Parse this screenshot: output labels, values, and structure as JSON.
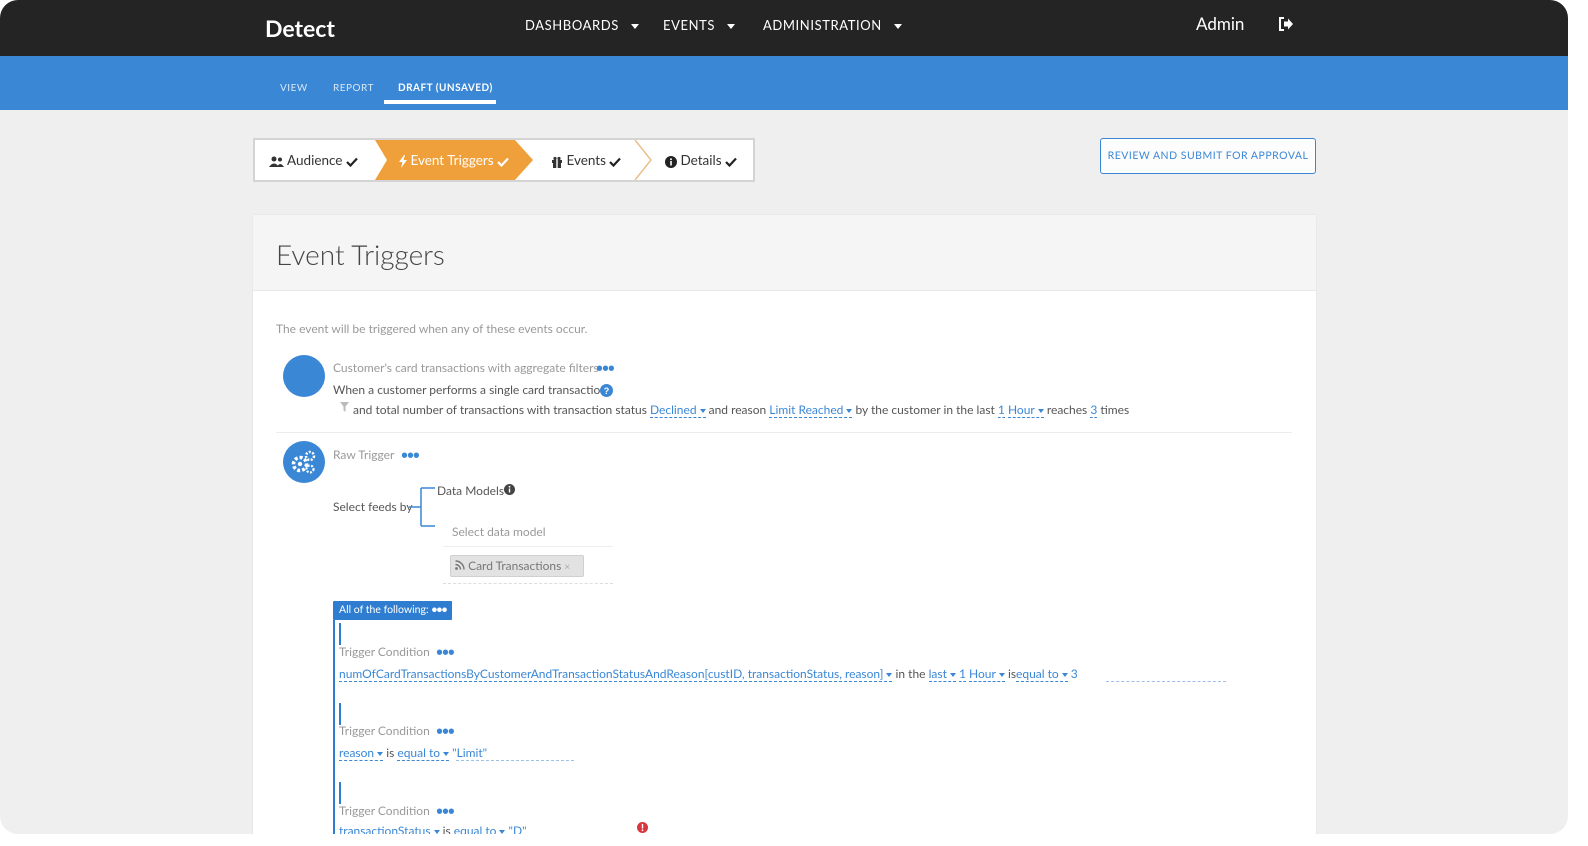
{
  "app": {
    "brand": "Detect"
  },
  "nav": {
    "items": [
      "DASHBOARDS",
      "EVENTS",
      "ADMINISTRATION"
    ],
    "user": "Admin"
  },
  "subnav": {
    "tabs": [
      "VIEW",
      "REPORT",
      "DRAFT (UNSAVED)"
    ],
    "active_tab": "DRAFT (UNSAVED)"
  },
  "wizard": {
    "steps": [
      {
        "label": "Audience",
        "icon": "users-icon",
        "done": true
      },
      {
        "label": "Event Triggers",
        "icon": "bolt-icon",
        "done": true,
        "active": true
      },
      {
        "label": "Events",
        "icon": "gift-icon",
        "done": true
      },
      {
        "label": "Details",
        "icon": "info-icon",
        "done": true
      }
    ],
    "submit_label": "REVIEW AND SUBMIT FOR APPROVAL"
  },
  "panel": {
    "title": "Event Triggers",
    "intro": "The event will be triggered when any of these events occur.",
    "trigger1": {
      "title": "Customer's card transactions with aggregate filters",
      "line1": "When a customer performs a single card transaction",
      "line2_a": "and total number of transactions with transaction status",
      "status_value": "Declined",
      "line2_b": "and reason",
      "reason_value": "Limit Reached",
      "line2_c": "by the customer in the last",
      "window_count": "1",
      "window_unit": "Hour",
      "line2_d": "reaches",
      "threshold": "3",
      "line2_e": "times"
    },
    "trigger2": {
      "title": "Raw Trigger",
      "select_feeds_label": "Select feeds by",
      "data_models_label": "Data Models",
      "select_placeholder": "Select data model",
      "selected_model": "Card Transactions",
      "group_label": "All of the following:",
      "conditions": [
        {
          "label": "Trigger Condition",
          "field": "numOfCardTransactionsByCustomerAndTransactionStatusAndReason[custID, transactionStatus, reason]",
          "in_the": "in the",
          "window_mode": "last",
          "count": "1",
          "unit": "Hour",
          "is": "is",
          "operator": "equal to",
          "value": "3"
        },
        {
          "label": "Trigger Condition",
          "field": "reason",
          "is": "is",
          "operator": "equal to",
          "value": "\"Limit\""
        },
        {
          "label": "Trigger Condition",
          "field": "transactionStatus",
          "is": "is",
          "operator": "equal to",
          "value": "\"D\""
        }
      ]
    }
  },
  "colors": {
    "topbar": "#242424",
    "accent": "#3a87d6",
    "step_active": "#f0a03a"
  }
}
